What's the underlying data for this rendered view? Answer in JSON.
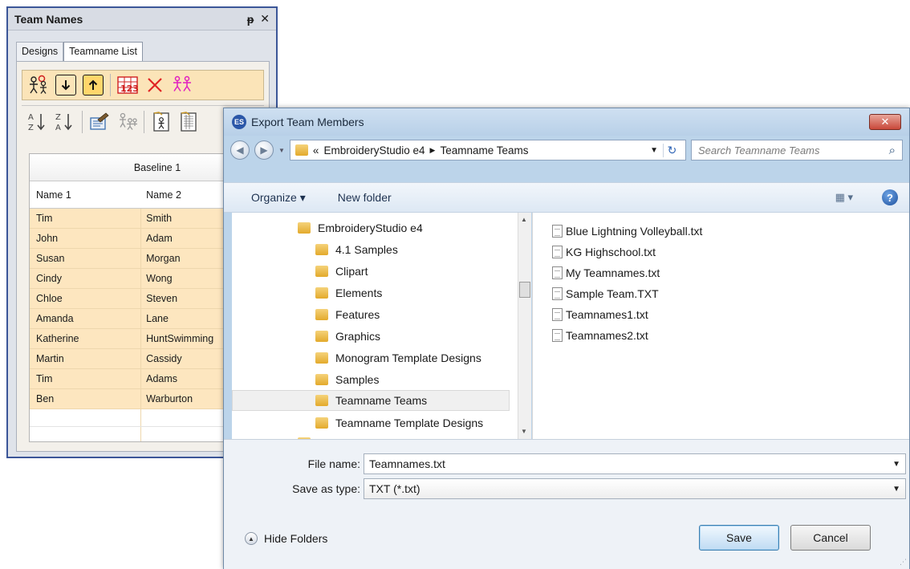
{
  "docker": {
    "title": "Team Names",
    "pin_glyph": "ᵽ",
    "close_glyph": "✕",
    "tabs": [
      "Designs",
      "Teamname List"
    ],
    "grid": {
      "baseline": "Baseline 1",
      "columns": [
        "Name 1",
        "Name 2"
      ],
      "rows": [
        [
          "Tim",
          "Smith"
        ],
        [
          "John",
          "Adam"
        ],
        [
          "Susan",
          "Morgan"
        ],
        [
          "Cindy",
          "Wong"
        ],
        [
          "Chloe",
          "Steven"
        ],
        [
          "Amanda",
          "Lane"
        ],
        [
          "Katherine",
          "HuntSwimming"
        ],
        [
          "Martin",
          "Cassidy"
        ],
        [
          "Tim",
          "Adams"
        ],
        [
          "Ben",
          "Warburton"
        ]
      ]
    },
    "colors": {
      "row_highlight": "#fde6bf",
      "toolbar_highlight": "#fbe4b8",
      "border_accent": "#3b5698"
    }
  },
  "dialog": {
    "title": "Export Team Members",
    "app_icon_text": "ES",
    "close_label": "✕",
    "breadcrumb": {
      "prefix": "«",
      "parts": [
        "EmbroideryStudio e4",
        "Teamname Teams"
      ]
    },
    "search_placeholder": "Search Teamname Teams",
    "toolbar": {
      "organize": "Organize ▾",
      "new_folder": "New folder",
      "help": "?"
    },
    "tree": {
      "root": "EmbroideryStudio e4",
      "items": [
        "4.1 Samples",
        "Clipart",
        "Elements",
        "Features",
        "Graphics",
        "Monogram Template Designs",
        "Samples",
        "Teamname Teams",
        "Teamname Template Designs"
      ],
      "selected": "Teamname Teams"
    },
    "files": [
      "Blue Lightning Volleyball.txt",
      "KG Highschool.txt",
      "My Teamnames.txt",
      "Sample Team.TXT",
      "Teamnames1.txt",
      "Teamnames2.txt"
    ],
    "file_name_label": "File name:",
    "file_name_value": "Teamnames.txt",
    "save_type_label": "Save as type:",
    "save_type_value": "TXT (*.txt)",
    "hide_folders": "Hide Folders",
    "save": "Save",
    "cancel": "Cancel",
    "colors": {
      "frame": "#bcd4ea",
      "close": "#c9483a",
      "save_border": "#3c7fb1"
    }
  }
}
